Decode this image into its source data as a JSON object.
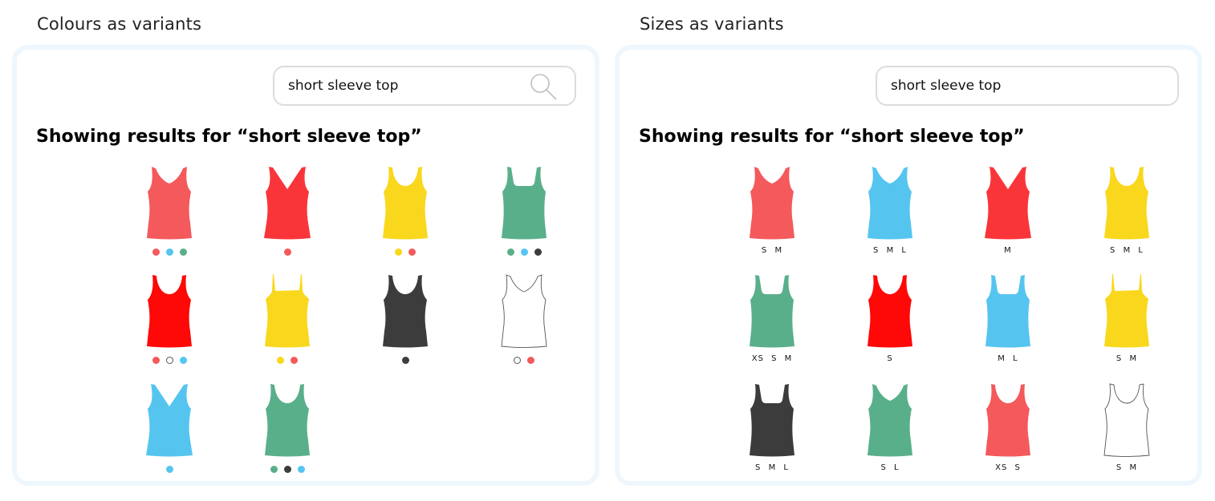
{
  "colors": {
    "coral": "#f4595b",
    "red": "#f93539",
    "yellow": "#f9d71c",
    "green": "#5aaf8b",
    "blue": "#55c5f0",
    "brightred": "#ff0808",
    "charcoal": "#3c3c3c",
    "white": "#ffffff",
    "outline": "#555555"
  },
  "left_panel": {
    "title": "Colours as variants",
    "search": {
      "value": "short sleeve top",
      "icon": "search-icon"
    },
    "heading": "Showing results for “short sleeve top”",
    "products": [
      {
        "style": "vneck",
        "color": "coral",
        "swatches": [
          "coral",
          "blue",
          "green"
        ]
      },
      {
        "style": "deepv",
        "color": "red",
        "swatches": [
          "coral"
        ]
      },
      {
        "style": "scoop",
        "color": "yellow",
        "swatches": [
          "yellow",
          "coral"
        ]
      },
      {
        "style": "square",
        "color": "green",
        "swatches": [
          "green",
          "blue",
          "charcoal"
        ]
      },
      {
        "style": "scoop",
        "color": "brightred",
        "swatches": [
          "coral",
          "white",
          "blue"
        ]
      },
      {
        "style": "cami",
        "color": "yellow",
        "swatches": [
          "yellow",
          "coral"
        ]
      },
      {
        "style": "scoop",
        "color": "charcoal",
        "swatches": [
          "charcoal"
        ]
      },
      {
        "style": "vneck",
        "color": "white",
        "swatches": [
          "white",
          "coral"
        ]
      },
      {
        "style": "deepv",
        "color": "blue",
        "swatches": [
          "blue"
        ]
      },
      {
        "style": "scoop",
        "color": "green",
        "swatches": [
          "green",
          "charcoal",
          "blue"
        ]
      }
    ]
  },
  "right_panel": {
    "title": "Sizes as variants",
    "search": {
      "value": "short sleeve top"
    },
    "heading": "Showing results for “short sleeve top”",
    "products": [
      {
        "style": "vneck",
        "color": "coral",
        "sizes": "S M"
      },
      {
        "style": "vneck",
        "color": "blue",
        "sizes": "S M L"
      },
      {
        "style": "deepv",
        "color": "red",
        "sizes": "M"
      },
      {
        "style": "scoop",
        "color": "yellow",
        "sizes": "S M L"
      },
      {
        "style": "square",
        "color": "green",
        "sizes": "XS S M"
      },
      {
        "style": "scoop",
        "color": "brightred",
        "sizes": "S"
      },
      {
        "style": "square",
        "color": "blue",
        "sizes": "M L"
      },
      {
        "style": "cami",
        "color": "yellow",
        "sizes": "S M"
      },
      {
        "style": "square",
        "color": "charcoal",
        "sizes": "S M L"
      },
      {
        "style": "vneck",
        "color": "green",
        "sizes": "S L"
      },
      {
        "style": "scoop",
        "color": "coral",
        "sizes": "XS S"
      },
      {
        "style": "scoop",
        "color": "white",
        "sizes": "S M"
      }
    ]
  }
}
